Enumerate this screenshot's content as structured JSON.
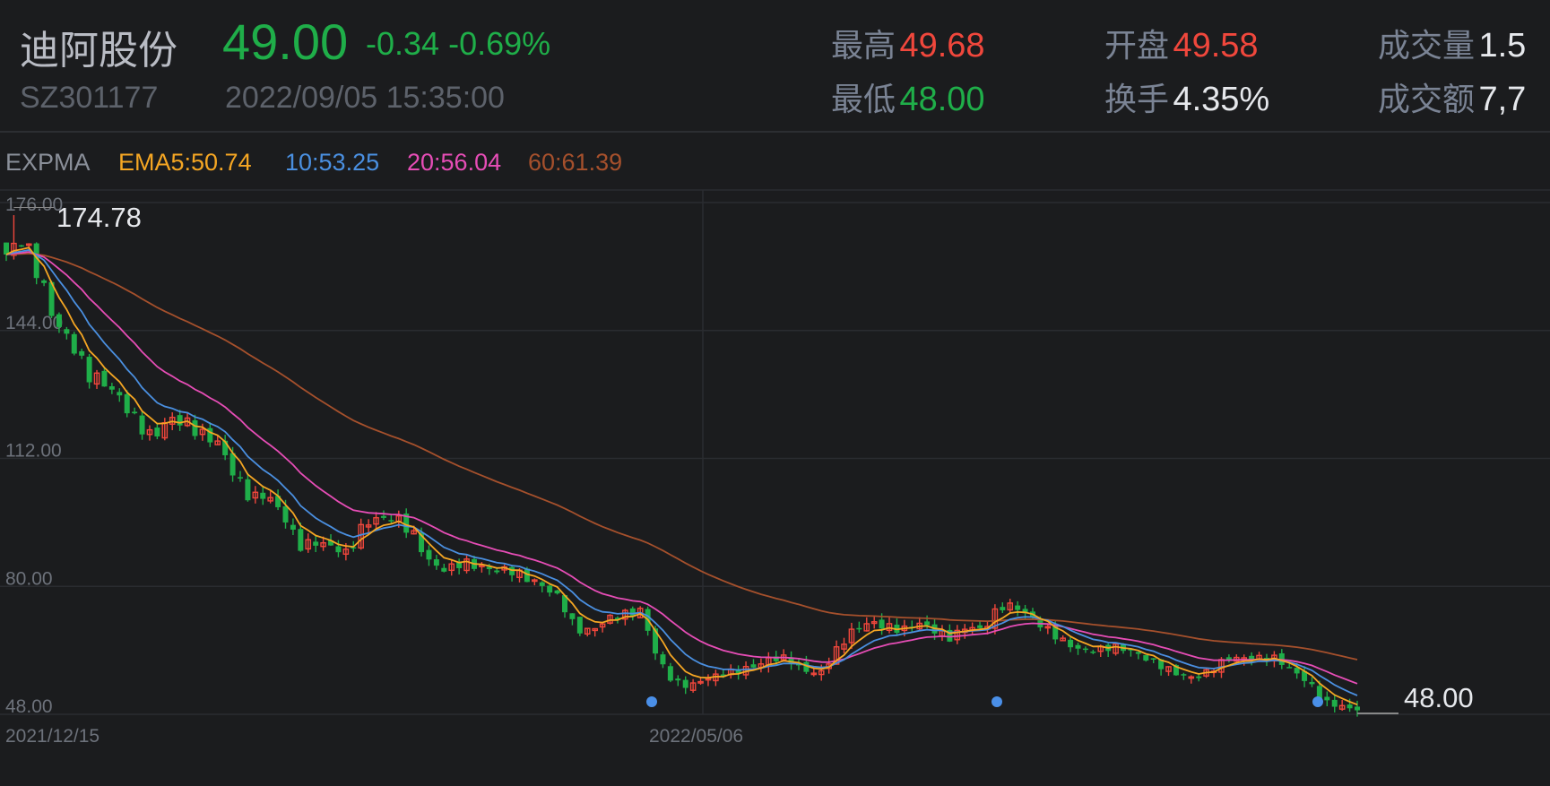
{
  "header": {
    "name": "迪阿股份",
    "price": "49.00",
    "change": "-0.34",
    "change_pct": "-0.69%",
    "code": "SZ301177",
    "datetime": "2022/09/05 15:35:00",
    "stats": [
      {
        "label": "最高",
        "value": "49.68",
        "tone": "red"
      },
      {
        "label": "最低",
        "value": "48.00",
        "tone": "green"
      },
      {
        "label": "开盘",
        "value": "49.58",
        "tone": "red"
      },
      {
        "label": "换手",
        "value": "4.35%",
        "tone": "white"
      },
      {
        "label": "成交量",
        "value": "1.5",
        "tone": "white"
      },
      {
        "label": "成交额",
        "value": "7,7",
        "tone": "white"
      }
    ]
  },
  "indicator": {
    "name": "EXPMA",
    "ema5": "EMA5:50.74",
    "ema10": "10:53.25",
    "ema20": "20:56.04",
    "ema60": "60:61.39"
  },
  "colors": {
    "up": "#f0473c",
    "down": "#1fae49",
    "ema5": "#f5a623",
    "ema10": "#4a8fe0",
    "ema20": "#e64db6",
    "ema60": "#a5502c",
    "marker": "#4a8fe8"
  },
  "chart_data": {
    "type": "candlestick",
    "title": "迪阿股份 EXPMA",
    "ylim": [
      48,
      176
    ],
    "y_ticks": [
      "176.00",
      "144.00",
      "112.00",
      "80.00",
      "48.00"
    ],
    "x_ticks": [
      "2021/12/15",
      "2022/05/06"
    ],
    "max_label": "174.78",
    "min_label": "48.00",
    "closes": [
      163,
      167,
      158,
      146,
      141,
      133,
      131,
      127,
      121,
      117,
      122,
      121,
      118,
      116,
      108,
      102,
      103,
      98,
      90,
      91,
      90,
      88,
      96,
      97,
      97,
      93,
      86,
      84,
      86,
      85,
      84,
      84,
      82,
      80,
      77,
      69,
      69,
      72,
      73,
      74,
      62,
      56,
      55,
      57,
      58,
      59,
      60,
      62,
      62,
      59,
      58,
      64,
      69,
      71,
      70,
      69,
      71,
      69,
      67,
      70,
      69,
      75,
      75,
      72,
      69,
      66,
      64,
      64,
      65,
      64,
      62,
      60,
      58,
      57,
      59,
      62,
      62,
      62,
      62,
      59,
      56,
      51,
      50,
      49
    ]
  }
}
